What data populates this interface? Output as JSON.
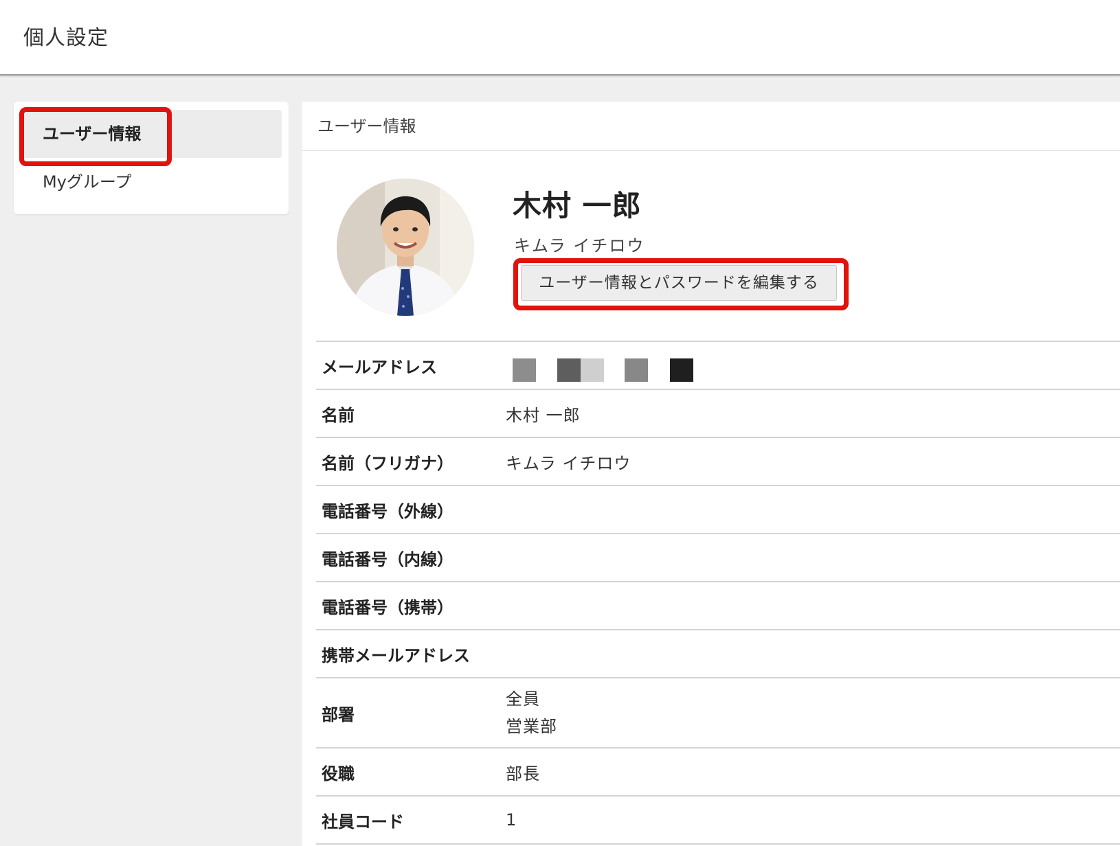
{
  "header": {
    "title": "個人設定"
  },
  "sidebar": {
    "items": [
      {
        "label": "ユーザー情報",
        "active": true
      },
      {
        "label": "Myグループ",
        "active": false
      }
    ]
  },
  "panel": {
    "title": "ユーザー情報"
  },
  "profile": {
    "name": "木村 一郎",
    "kana": "キムラ イチロウ",
    "edit_button_label": "ユーザー情報とパスワードを編集する"
  },
  "fields": [
    {
      "label": "メールアドレス",
      "value": ""
    },
    {
      "label": "名前",
      "value": "木村 一郎"
    },
    {
      "label": "名前（フリガナ）",
      "value": "キムラ イチロウ"
    },
    {
      "label": "電話番号（外線）",
      "value": ""
    },
    {
      "label": "電話番号（内線）",
      "value": ""
    },
    {
      "label": "電話番号（携帯）",
      "value": ""
    },
    {
      "label": "携帯メールアドレス",
      "value": ""
    },
    {
      "label": "部署",
      "values": [
        "全員",
        "営業部"
      ]
    },
    {
      "label": "役職",
      "value": "部長"
    },
    {
      "label": "社員コード",
      "value": "1"
    }
  ],
  "email_mask_colors": [
    "#8d8d8d",
    "#5e5e5e",
    "#cfcfcf",
    "#888888",
    "#1f1f1f"
  ],
  "highlight_color": "#e0130d"
}
